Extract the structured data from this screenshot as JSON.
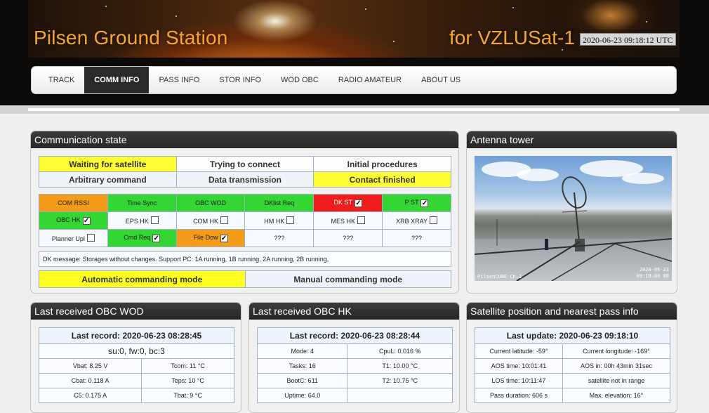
{
  "header": {
    "title": "Pilsen Ground Station",
    "subtitle": "for VZLUSat-1",
    "clock": "2020-06-23 09:18:12 UTC"
  },
  "nav": [
    "TRACK",
    "COMM INFO",
    "PASS INFO",
    "STOR INFO",
    "WOD OBC",
    "RADIO AMATEUR",
    "ABOUT US"
  ],
  "nav_active": "COMM INFO",
  "comm": {
    "title": "Communication state",
    "states": [
      [
        "Waiting for satellite",
        "Trying to connect",
        "Initial procedures"
      ],
      [
        "Arbitrary command",
        "Data transmission",
        "Contact finished"
      ]
    ],
    "flags": [
      [
        {
          "label": "COM RSSI",
          "color": "orange"
        },
        {
          "label": "Time Sync",
          "color": "green"
        },
        {
          "label": "OBC WOD",
          "color": "green"
        },
        {
          "label": "DKlist Req",
          "color": "green"
        },
        {
          "label": "DK ST",
          "color": "red",
          "checked": true
        },
        {
          "label": "P ST",
          "color": "green",
          "checked": true
        }
      ],
      [
        {
          "label": "OBC HK",
          "color": "green",
          "checked": true
        },
        {
          "label": "EPS HK",
          "checked": false
        },
        {
          "label": "COM HK",
          "checked": false
        },
        {
          "label": "HM HK",
          "checked": false
        },
        {
          "label": "MES HK",
          "checked": false
        },
        {
          "label": "XRB XRAY",
          "checked": false
        }
      ],
      [
        {
          "label": "Planner Upl",
          "checked": false
        },
        {
          "label": "Cmd Req",
          "color": "green",
          "checked": true
        },
        {
          "label": "File Dow",
          "color": "orange",
          "checked": true
        },
        {
          "label": "???"
        },
        {
          "label": "???"
        },
        {
          "label": "???"
        }
      ]
    ],
    "dk_message": "DK message: Storages without changes.    Support PC: 1A running, 1B running, 2A running, 2B running,",
    "modes": [
      "Automatic commanding mode",
      "Manual commanding mode"
    ]
  },
  "antenna": {
    "title": "Antenna tower",
    "caption_left": "PilsenCUBE Ch.1",
    "caption_date": "2020-06-23",
    "caption_time": "09:18:00 00"
  },
  "wod": {
    "title": "Last received OBC WOD",
    "record": "Last record: 2020-06-23 08:28:45",
    "sub": "su:0, fw:0, bc:3",
    "rows": [
      [
        "Vbat: 8.25 V",
        "Tcom: 11 °C"
      ],
      [
        "Cbat: 0.118 A",
        "Teps: 10 °C"
      ],
      [
        "C5: 0.175 A",
        "Tbat: 9 °C"
      ]
    ]
  },
  "hk": {
    "title": "Last received OBC HK",
    "record": "Last record: 2020-06-23 08:28:44",
    "rows": [
      [
        "Mode: 4",
        "CpuL: 0.016 %"
      ],
      [
        "Tasks: 16",
        "T1: 10.00 °C"
      ],
      [
        "BootC: 611",
        "T2: 10.75 °C"
      ],
      [
        "Uptime: 64.0",
        ""
      ]
    ]
  },
  "pos": {
    "title": "Satellite position and nearest pass info",
    "record": "Last update: 2020-06-23 09:18:10",
    "rows": [
      [
        "Current latitude: -59°",
        "Current longitude: -169°"
      ],
      [
        "AOS time: 10:01:41",
        "AOS in: 00h 43min 31sec"
      ],
      [
        "LOS time: 10:11:47",
        "satellite not in range"
      ],
      [
        "Pass duration: 606 s",
        "Max. elevation: 16°"
      ]
    ]
  },
  "colors": {
    "yellow": "#ffff33",
    "green": "#33d633",
    "red": "#ef1c1c",
    "orange": "#f59b1a",
    "panel_header": "#2a2a2a",
    "brand": "#f5a830"
  }
}
